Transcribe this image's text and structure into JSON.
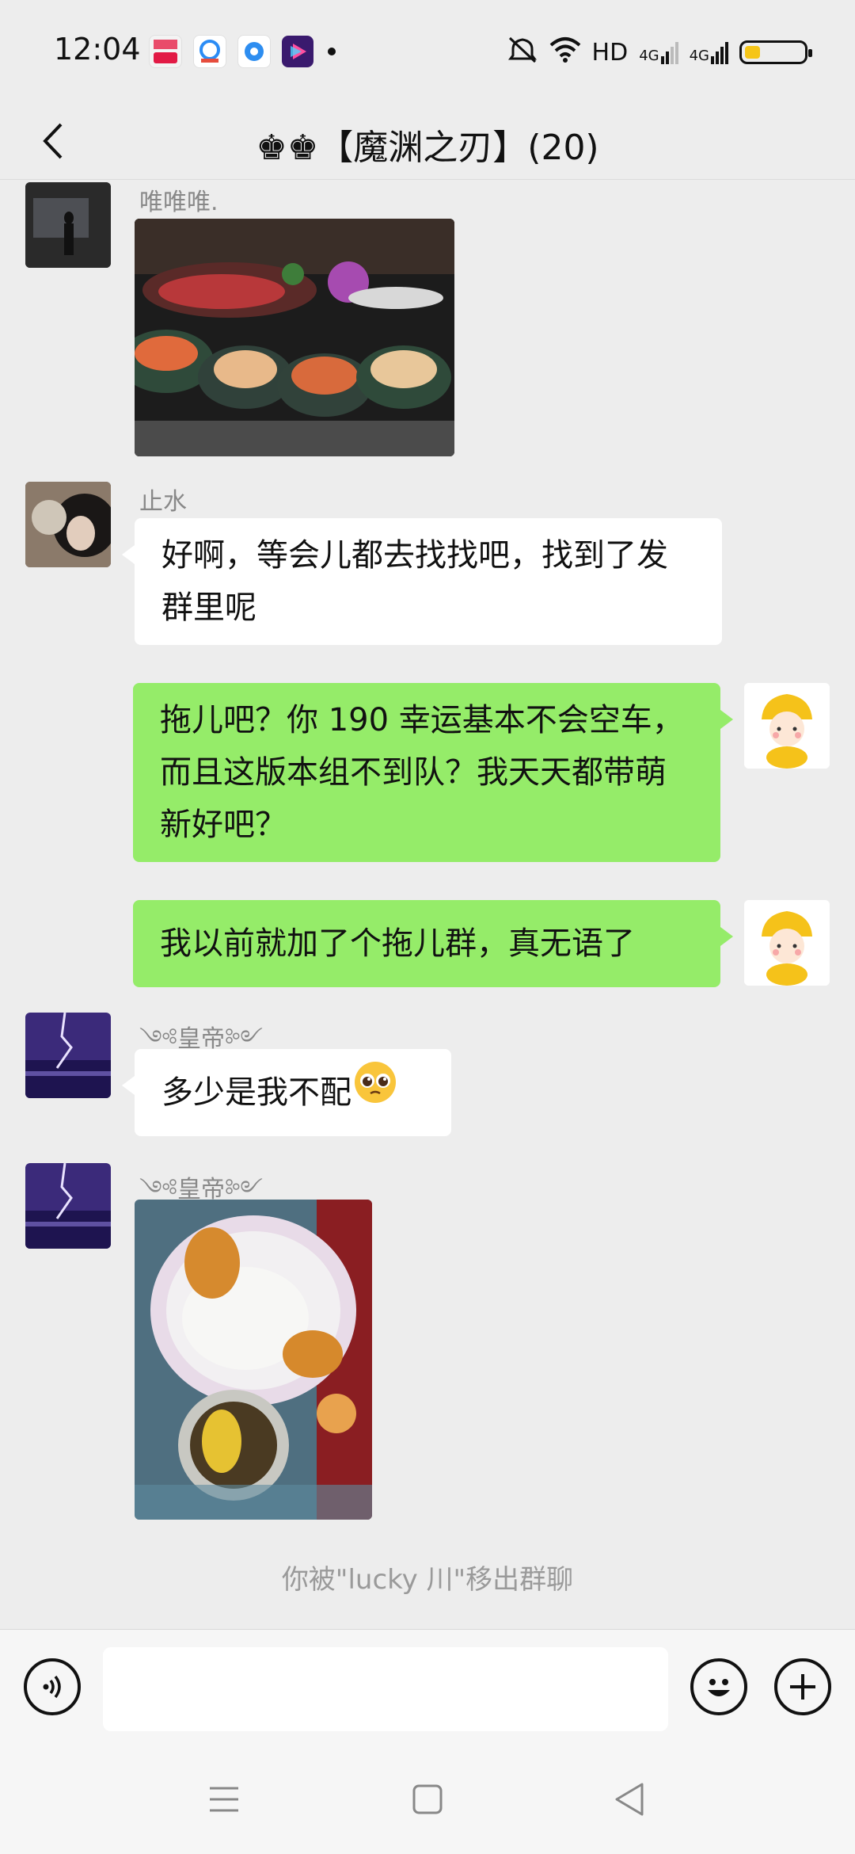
{
  "status_bar": {
    "time": "12:04",
    "network_label": "HD",
    "signal_label_1": "4G",
    "signal_label_2": "4G",
    "notification_icons": [
      "video-app-icon",
      "browser-app-icon",
      "circle-app-icon",
      "player-app-icon"
    ],
    "battery_level": 0.25
  },
  "header": {
    "title": "♚♚【魔渊之刃】(20)"
  },
  "messages": [
    {
      "sender": "唯唯唯.",
      "type": "image",
      "direction": "in",
      "image": "seafood-dinner-photo"
    },
    {
      "sender": "止水",
      "type": "text",
      "direction": "in",
      "text": "好啊，等会儿都去找找吧，找到了发群里呢"
    },
    {
      "sender": "",
      "type": "text",
      "direction": "out",
      "text": "拖儿吧？你 190 幸运基本不会空车，而且这版本组不到队？我天天都带萌新好吧？"
    },
    {
      "sender": "",
      "type": "text",
      "direction": "out",
      "text": "我以前就加了个拖儿群，真无语了"
    },
    {
      "sender": "༺皇帝༻",
      "type": "text",
      "direction": "in",
      "text": "多少是我不配",
      "emoji": "pleading-face"
    },
    {
      "sender": "༺皇帝༻",
      "type": "image",
      "direction": "in",
      "image": "rice-meal-photo"
    }
  ],
  "system_note": "你被\"lucky 川\"移出群聊",
  "input_bar": {
    "placeholder": "",
    "voice_icon": "voice-icon",
    "emoji_icon": "emoji-icon",
    "plus_icon": "plus-icon"
  },
  "colors": {
    "background": "#ededed",
    "outgoing_bubble": "#95ec69",
    "incoming_bubble": "#ffffff"
  }
}
